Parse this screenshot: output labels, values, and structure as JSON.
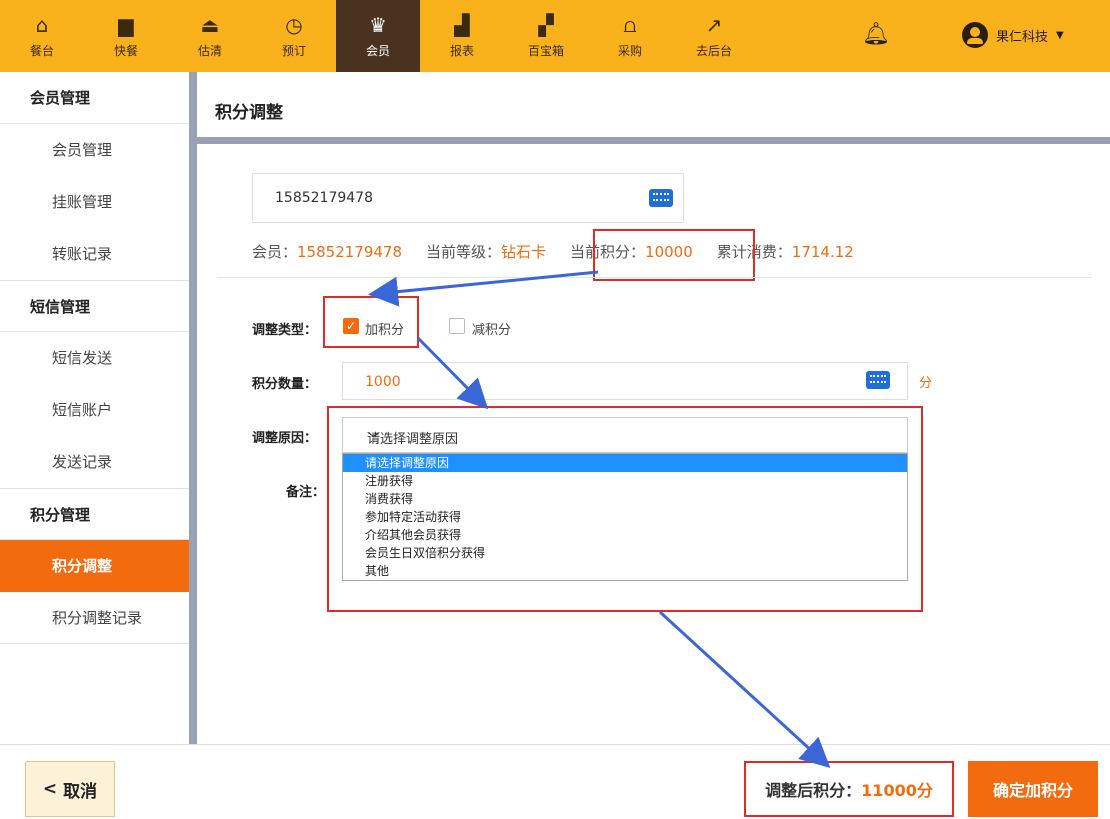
{
  "topnav": {
    "items": [
      {
        "label": "餐台",
        "icon": "table-icon"
      },
      {
        "label": "快餐",
        "icon": "fastfood-icon"
      },
      {
        "label": "估清",
        "icon": "bell-dish-icon"
      },
      {
        "label": "预订",
        "icon": "clock-icon"
      },
      {
        "label": "会员",
        "icon": "crown-icon"
      },
      {
        "label": "报表",
        "icon": "report-icon"
      },
      {
        "label": "百宝箱",
        "icon": "grid-icon"
      },
      {
        "label": "采购",
        "icon": "basket-icon"
      },
      {
        "label": "去后台",
        "icon": "external-link-icon"
      }
    ],
    "active": "会员",
    "user_name": "果仁科技"
  },
  "sidebar": {
    "groups": [
      {
        "title": "会员管理",
        "items": [
          "会员管理",
          "挂账管理",
          "转账记录"
        ]
      },
      {
        "title": "短信管理",
        "items": [
          "短信发送",
          "短信账户",
          "发送记录"
        ]
      },
      {
        "title": "积分管理",
        "items": [
          "积分调整",
          "积分调整记录"
        ]
      }
    ],
    "active_item": "积分调整"
  },
  "page": {
    "title": "积分调整"
  },
  "form": {
    "phone_value": "15852179478",
    "member_label": "会员：",
    "member_value": "15852179478",
    "level_label": "当前等级：",
    "level_value": "钻石卡",
    "points_label": "当前积分：",
    "points_value": "10000",
    "spend_label": "累计消费：",
    "spend_value": "1714.12",
    "type_label": "调整类型：",
    "type_add": "加积分",
    "type_sub": "减积分",
    "amount_label": "积分数量：",
    "amount_value": "1000",
    "amount_unit": "分",
    "reason_label": "调整原因：",
    "reason_placeholder": "请选择调整原因",
    "reason_options": [
      "请选择调整原因",
      "注册获得",
      "消费获得",
      "参加特定活动获得",
      "介绍其他会员获得",
      "会员生日双倍积分获得",
      "其他"
    ],
    "note_label": "备注："
  },
  "footer": {
    "cancel_label": "取消",
    "after_label": "调整后积分：",
    "after_value": "11000分",
    "confirm_label": "确定加积分"
  },
  "colors": {
    "accent": "#f26b0f",
    "topbar": "#f9b21b",
    "highlight": "#e02b2b",
    "arrow": "#3b67d6"
  }
}
